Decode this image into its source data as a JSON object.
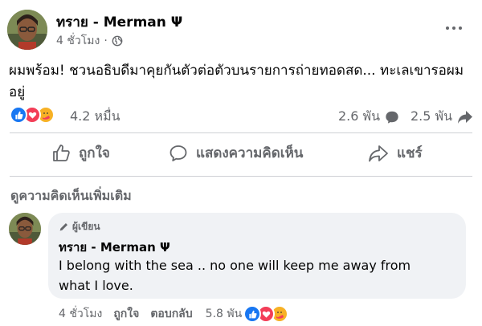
{
  "post": {
    "author": "ทราย - Merman Ψ",
    "time": "4 ชั่วโมง",
    "privacy_icon": "globe-icon",
    "text": "ผมพร้อม! ชวนอธิบดีมาคุยกันตัวต่อตัวบนรายการถ่ายทอดสด...  ทะเลเขารอผมอยู่",
    "reaction_count": "4.2 หมื่น",
    "comment_count": "2.6 พัน",
    "share_count": "2.5 พัน",
    "reactions": [
      "like",
      "love",
      "care"
    ]
  },
  "actions": {
    "like": "ถูกใจ",
    "comment": "แสดงความคิดเห็น",
    "share": "แชร์"
  },
  "view_more_comments": "ดูความคิดเห็นเพิ่มเติม",
  "comment": {
    "badge": "ผู้เขียน",
    "author": "ทราย - Merman Ψ",
    "text": "I belong with the sea .. no one will keep me away from what I love.",
    "time": "4 ชั่วโมง",
    "like_label": "ถูกใจ",
    "reply_label": "ตอบกลับ",
    "reaction_count": "5.8 พัน"
  },
  "colors": {
    "like_blue": "#1877f2",
    "love_red": "#f33e58",
    "care_yellow": "#f7b125",
    "muted_gray": "#65676b",
    "bubble_bg": "#f0f2f5"
  }
}
